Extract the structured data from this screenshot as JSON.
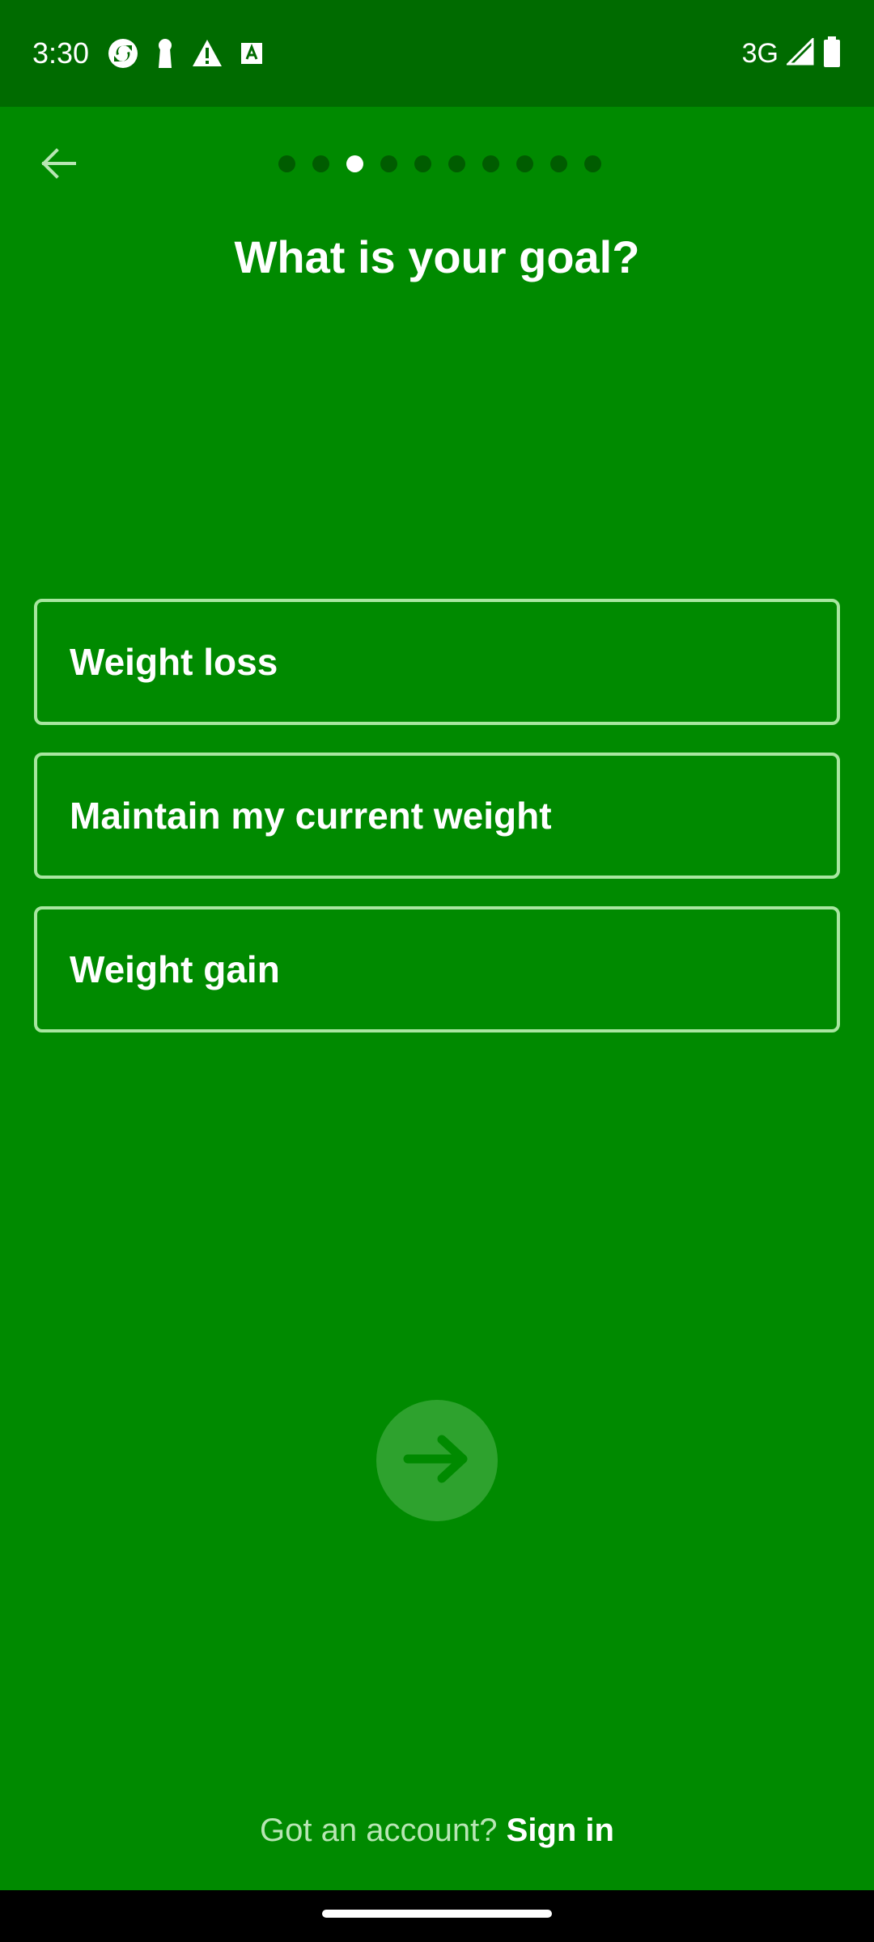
{
  "status_bar": {
    "time": "3:30",
    "network": "3G",
    "icons": [
      "sync-icon",
      "keyhole-icon",
      "warning-icon",
      "font-icon",
      "signal-icon",
      "battery-icon"
    ]
  },
  "header": {
    "back_icon": "arrow-left-icon",
    "progress": {
      "total_steps": 10,
      "current_step": 3
    }
  },
  "page": {
    "title": "What is your goal?"
  },
  "options": [
    {
      "label": "Weight loss"
    },
    {
      "label": "Maintain my current weight"
    },
    {
      "label": "Weight gain"
    }
  ],
  "next_button": {
    "icon": "arrow-right-icon",
    "enabled": false
  },
  "footer": {
    "prompt": "Got an account?",
    "link": "Sign in"
  },
  "colors": {
    "background": "#008a00",
    "status_bar": "#006b00",
    "option_border": "#a8e6a0",
    "dot_inactive": "#005c00",
    "dot_active": "#ffffff",
    "next_button_bg": "#2ea22e",
    "next_button_arrow": "#008a00"
  }
}
